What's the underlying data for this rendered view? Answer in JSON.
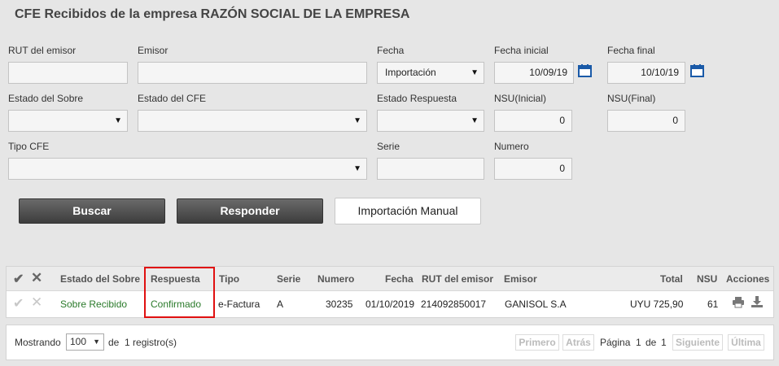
{
  "page": {
    "title": "CFE Recibidos de la empresa RAZÓN SOCIAL DE LA EMPRESA"
  },
  "filters": {
    "rut_emisor": {
      "label": "RUT del emisor",
      "value": ""
    },
    "emisor": {
      "label": "Emisor",
      "value": ""
    },
    "fecha": {
      "label": "Fecha",
      "value": "Importación"
    },
    "fecha_inicial": {
      "label": "Fecha inicial",
      "value": "10/09/19"
    },
    "fecha_final": {
      "label": "Fecha final",
      "value": "10/10/19"
    },
    "estado_sobre": {
      "label": "Estado del Sobre",
      "value": ""
    },
    "estado_cfe": {
      "label": "Estado del CFE",
      "value": ""
    },
    "estado_respuesta": {
      "label": "Estado Respuesta",
      "value": ""
    },
    "nsu_inicial": {
      "label": "NSU(Inicial)",
      "value": "0"
    },
    "nsu_final": {
      "label": "NSU(Final)",
      "value": "0"
    },
    "tipo_cfe": {
      "label": "Tipo CFE",
      "value": ""
    },
    "serie": {
      "label": "Serie",
      "value": ""
    },
    "numero": {
      "label": "Numero",
      "value": "0"
    }
  },
  "buttons": {
    "buscar": "Buscar",
    "responder": "Responder",
    "importacion_manual": "Importación Manual"
  },
  "table": {
    "headers": [
      "Estado del Sobre",
      "Respuesta",
      "Tipo",
      "Serie",
      "Numero",
      "Fecha",
      "RUT del emisor",
      "Emisor",
      "Total",
      "NSU",
      "Acciones"
    ],
    "rows": [
      {
        "estado_sobre": "Sobre Recibido",
        "respuesta": "Confirmado",
        "tipo": "e-Factura",
        "serie": "A",
        "numero": "30235",
        "fecha": "01/10/2019",
        "rut": "214092850017",
        "emisor": "GANISOL S.A",
        "total": "UYU 725,90",
        "nsu": "61"
      }
    ]
  },
  "pager": {
    "mostrando": "Mostrando",
    "page_size": "100",
    "de_registros": "de  1 registro(s)",
    "primero": "Primero",
    "atras": "Atrás",
    "pagina": "Página",
    "current": "1",
    "de": "de",
    "total": "1",
    "siguiente": "Siguiente",
    "ultima": "Última"
  },
  "colors": {
    "accent_dark": "#3d3d3d",
    "status_green": "#2a7a2a",
    "highlight_red": "#e01010",
    "calendar_blue": "#1a5aa8"
  },
  "icons": [
    "check-icon",
    "close-icon",
    "calendar-icon",
    "print-icon",
    "download-icon"
  ]
}
